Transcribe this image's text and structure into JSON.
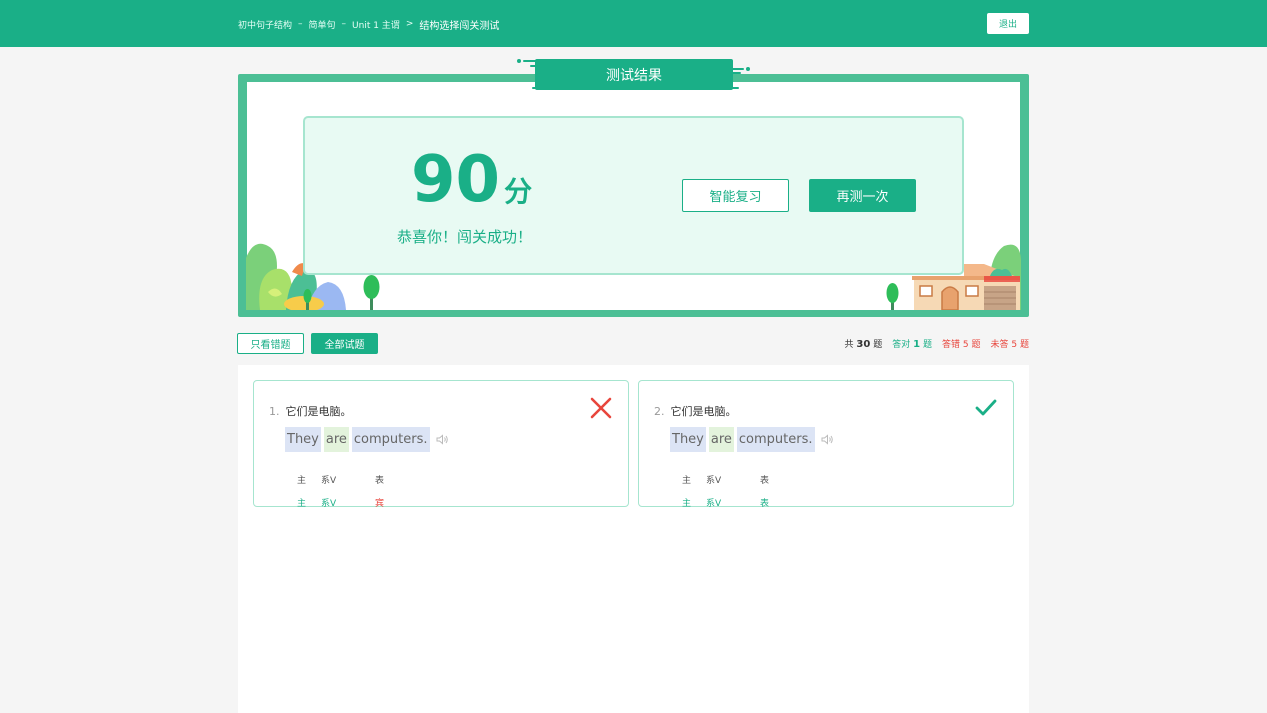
{
  "header": {
    "breadcrumb": [
      "初中句子结构",
      "简单句",
      "Unit 1 主谓"
    ],
    "separator": "–",
    "arrow": ">",
    "current": "结构选择闯关测试",
    "exit_label": "退出"
  },
  "result": {
    "title": "测试结果",
    "score": "90",
    "score_unit": "分",
    "message": "恭喜你！闯关成功！",
    "review_label": "智能复习",
    "retry_label": "再测一次"
  },
  "filters": {
    "wrong_only_label": "只看错题",
    "all_label": "全部试题"
  },
  "stats": {
    "total_prefix": "共",
    "total": "30",
    "correct_prefix": "答对",
    "correct": "1",
    "wrong_prefix": "答错",
    "wrong": "5",
    "unanswered_prefix": "未答",
    "unanswered": "5",
    "suffix": "题"
  },
  "questions": [
    {
      "number": "1.",
      "prompt": "它们是电脑。",
      "words": [
        "They",
        "are",
        "computers."
      ],
      "answer": [
        "主",
        "系V",
        "表"
      ],
      "key": [
        "主",
        "系V",
        "宾"
      ],
      "result": "wrong",
      "result_icon": "cross-icon"
    },
    {
      "number": "2.",
      "prompt": "它们是电脑。",
      "words": [
        "They",
        "are",
        "computers."
      ],
      "answer": [
        "主",
        "系V",
        "表"
      ],
      "key": [
        "主",
        "系V",
        "表"
      ],
      "result": "correct",
      "result_icon": "check-icon"
    }
  ],
  "colors": {
    "accent": "#1aaf87",
    "error": "#e8453c",
    "card_border": "#a6e5cf"
  }
}
